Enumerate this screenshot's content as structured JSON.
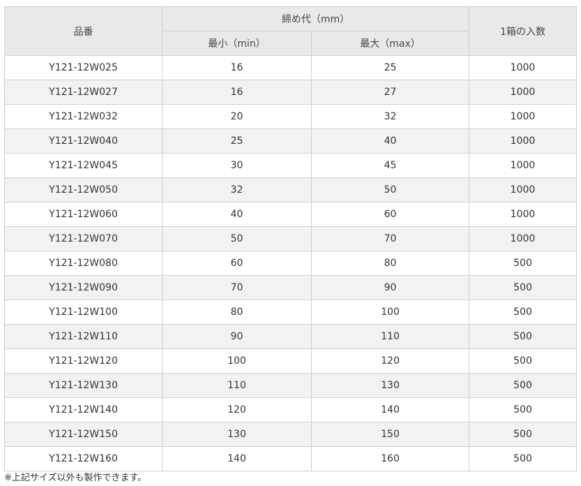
{
  "table": {
    "headers": {
      "part_number": "品番",
      "tightening_range": "締め代（mm）",
      "min": "最小（min）",
      "max": "最大（max）",
      "per_box": "1箱の入数"
    },
    "rows": [
      {
        "part": "Y121-12W025",
        "min": "16",
        "max": "25",
        "qty": "1000"
      },
      {
        "part": "Y121-12W027",
        "min": "16",
        "max": "27",
        "qty": "1000"
      },
      {
        "part": "Y121-12W032",
        "min": "20",
        "max": "32",
        "qty": "1000"
      },
      {
        "part": "Y121-12W040",
        "min": "25",
        "max": "40",
        "qty": "1000"
      },
      {
        "part": "Y121-12W045",
        "min": "30",
        "max": "45",
        "qty": "1000"
      },
      {
        "part": "Y121-12W050",
        "min": "32",
        "max": "50",
        "qty": "1000"
      },
      {
        "part": "Y121-12W060",
        "min": "40",
        "max": "60",
        "qty": "1000"
      },
      {
        "part": "Y121-12W070",
        "min": "50",
        "max": "70",
        "qty": "1000"
      },
      {
        "part": "Y121-12W080",
        "min": "60",
        "max": "80",
        "qty": "500"
      },
      {
        "part": "Y121-12W090",
        "min": "70",
        "max": "90",
        "qty": "500"
      },
      {
        "part": "Y121-12W100",
        "min": "80",
        "max": "100",
        "qty": "500"
      },
      {
        "part": "Y121-12W110",
        "min": "90",
        "max": "110",
        "qty": "500"
      },
      {
        "part": "Y121-12W120",
        "min": "100",
        "max": "120",
        "qty": "500"
      },
      {
        "part": "Y121-12W130",
        "min": "110",
        "max": "130",
        "qty": "500"
      },
      {
        "part": "Y121-12W140",
        "min": "120",
        "max": "140",
        "qty": "500"
      },
      {
        "part": "Y121-12W150",
        "min": "130",
        "max": "150",
        "qty": "500"
      },
      {
        "part": "Y121-12W160",
        "min": "140",
        "max": "160",
        "qty": "500"
      }
    ]
  },
  "note": "※上記サイズ以外も製作できます。"
}
